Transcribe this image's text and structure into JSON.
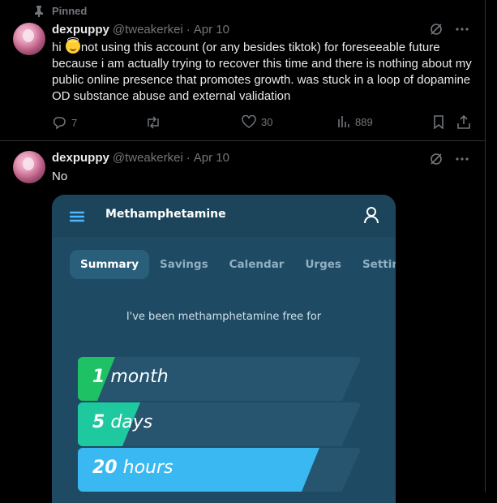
{
  "pinned": {
    "label": "Pinned"
  },
  "posts": [
    {
      "display_name": "dexpuppy",
      "handle": "@tweakerkei",
      "separator": "·",
      "date": "Apr 10",
      "text_before_emoji": "hi ",
      "emoji": "smiling-face-with-halo",
      "text_after_emoji": "not using this account (or any besides tiktok) for foreseeable future because i am actually trying to recover this time and there is nothing about my public online presence that promotes growth. was stuck in a loop of dopamine OD substance abuse and external validation",
      "replies": "7",
      "reposts": "",
      "likes": "30",
      "views": "889"
    },
    {
      "display_name": "dexpuppy",
      "handle": "@tweakerkei",
      "separator": "·",
      "date": "Apr 10",
      "text": "No"
    }
  ],
  "app": {
    "title": "Methamphetamine",
    "tabs": [
      "Summary",
      "Savings",
      "Calendar",
      "Urges",
      "Settings"
    ],
    "active_tab": "Summary",
    "free_for": "I've been methamphetamine free for",
    "counters": [
      {
        "value": "1",
        "unit": "month",
        "fill_fraction": 0.13,
        "color": "#1ec264"
      },
      {
        "value": "5",
        "unit": "days",
        "fill_fraction": 0.22,
        "color": "#1fc9a0"
      },
      {
        "value": "20",
        "unit": "hours",
        "fill_fraction": 0.85,
        "color": "#39b8f2"
      }
    ]
  },
  "colors": {
    "background": "#000000",
    "text": "#e7e9ea",
    "muted": "#71767b",
    "app_bg": "#1e4a63"
  }
}
